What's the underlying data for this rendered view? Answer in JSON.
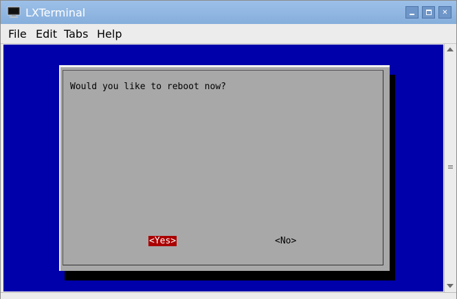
{
  "window": {
    "title": "LXTerminal",
    "minimize_label": "▪",
    "maximize_label": "▫",
    "close_label": "✕"
  },
  "menu": {
    "items": [
      {
        "label": "File"
      },
      {
        "label": "Edit"
      },
      {
        "label": "Tabs"
      },
      {
        "label": "Help"
      }
    ]
  },
  "colors": {
    "terminal_background": "#0000aa",
    "dialog_background": "#a8a8a8",
    "selected_button": "#aa0000"
  },
  "dialog": {
    "message": "Would you like to reboot now?",
    "yes_label": "<Yes>",
    "no_label": "<No>",
    "selected": "yes"
  }
}
